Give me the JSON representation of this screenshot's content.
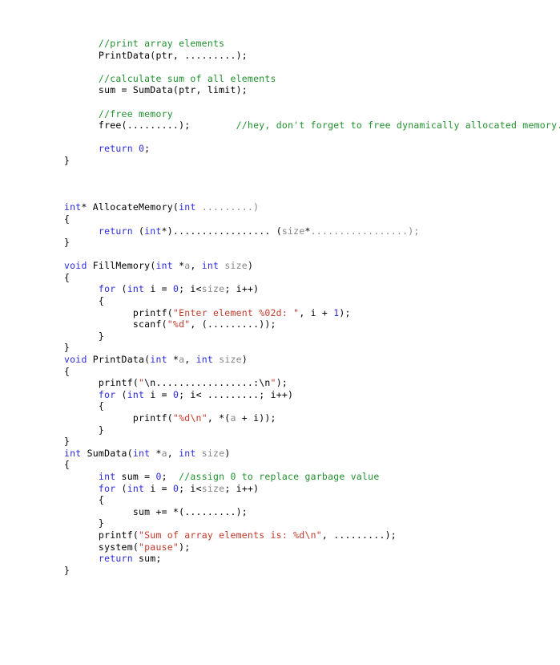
{
  "document": {
    "kind": "c-source-code-listing",
    "language": "C",
    "background_color": "#ffffff",
    "colors": {
      "keyword": "#2b2be0",
      "comment": "#22912f",
      "string": "#c23a2b",
      "identifier_grey": "#878787",
      "plain": "#000000"
    }
  },
  "code": {
    "lines": [
      {
        "indent": 6,
        "tokens": [
          {
            "t": "cmt",
            "v": "//print array elements"
          }
        ]
      },
      {
        "indent": 6,
        "tokens": [
          {
            "t": "pln",
            "v": "PrintData(ptr, .........);"
          }
        ]
      },
      {
        "indent": 0,
        "tokens": []
      },
      {
        "indent": 6,
        "tokens": [
          {
            "t": "cmt",
            "v": "//calculate sum of all elements"
          }
        ]
      },
      {
        "indent": 6,
        "tokens": [
          {
            "t": "pln",
            "v": "sum = SumData(ptr, limit);"
          }
        ]
      },
      {
        "indent": 0,
        "tokens": []
      },
      {
        "indent": 6,
        "tokens": [
          {
            "t": "cmt",
            "v": "//free memory"
          }
        ]
      },
      {
        "indent": 6,
        "tokens": [
          {
            "t": "pln",
            "v": "free(.........);"
          },
          {
            "t": "pln",
            "v": "        "
          },
          {
            "t": "cmt",
            "v": "//hey, don't forget to free dynamically allocated memory."
          }
        ]
      },
      {
        "indent": 0,
        "tokens": []
      },
      {
        "indent": 6,
        "tokens": [
          {
            "t": "kw",
            "v": "return"
          },
          {
            "t": "pln",
            "v": " "
          },
          {
            "t": "kw",
            "v": "0"
          },
          {
            "t": "pln",
            "v": ";"
          }
        ]
      },
      {
        "indent": 0,
        "tokens": [
          {
            "t": "pln",
            "v": "}"
          }
        ]
      },
      {
        "indent": 0,
        "tokens": []
      },
      {
        "indent": 0,
        "tokens": []
      },
      {
        "indent": 0,
        "tokens": []
      },
      {
        "indent": 0,
        "tokens": [
          {
            "t": "kw",
            "v": "int"
          },
          {
            "t": "pln",
            "v": "* AllocateMemory("
          },
          {
            "t": "kw",
            "v": "int"
          },
          {
            "t": "pln",
            "v": " "
          },
          {
            "t": "gry",
            "v": ".........)"
          }
        ]
      },
      {
        "indent": 0,
        "tokens": [
          {
            "t": "pln",
            "v": "{"
          }
        ]
      },
      {
        "indent": 6,
        "tokens": [
          {
            "t": "kw",
            "v": "return"
          },
          {
            "t": "pln",
            "v": " ("
          },
          {
            "t": "kw",
            "v": "int"
          },
          {
            "t": "pln",
            "v": "*)................. ("
          },
          {
            "t": "gry",
            "v": "size"
          },
          {
            "t": "pln",
            "v": "*"
          },
          {
            "t": "gry",
            "v": ".................);"
          }
        ]
      },
      {
        "indent": 0,
        "tokens": [
          {
            "t": "pln",
            "v": "}"
          }
        ]
      },
      {
        "indent": 0,
        "tokens": []
      },
      {
        "indent": 0,
        "tokens": [
          {
            "t": "kw",
            "v": "void"
          },
          {
            "t": "pln",
            "v": " FillMemory("
          },
          {
            "t": "kw",
            "v": "int"
          },
          {
            "t": "pln",
            "v": " *"
          },
          {
            "t": "gry",
            "v": "a"
          },
          {
            "t": "pln",
            "v": ", "
          },
          {
            "t": "kw",
            "v": "int"
          },
          {
            "t": "pln",
            "v": " "
          },
          {
            "t": "gry",
            "v": "size"
          },
          {
            "t": "pln",
            "v": ")"
          }
        ]
      },
      {
        "indent": 0,
        "tokens": [
          {
            "t": "pln",
            "v": "{"
          }
        ]
      },
      {
        "indent": 6,
        "tokens": [
          {
            "t": "kw",
            "v": "for"
          },
          {
            "t": "pln",
            "v": " ("
          },
          {
            "t": "kw",
            "v": "int"
          },
          {
            "t": "pln",
            "v": " i = "
          },
          {
            "t": "kw",
            "v": "0"
          },
          {
            "t": "pln",
            "v": "; i<"
          },
          {
            "t": "gry",
            "v": "size"
          },
          {
            "t": "pln",
            "v": "; i++)"
          }
        ]
      },
      {
        "indent": 6,
        "tokens": [
          {
            "t": "pln",
            "v": "{"
          }
        ]
      },
      {
        "indent": 12,
        "tokens": [
          {
            "t": "pln",
            "v": "printf("
          },
          {
            "t": "str",
            "v": "\"Enter element %02d: \""
          },
          {
            "t": "pln",
            "v": ", i + "
          },
          {
            "t": "kw",
            "v": "1"
          },
          {
            "t": "pln",
            "v": ");"
          }
        ]
      },
      {
        "indent": 12,
        "tokens": [
          {
            "t": "pln",
            "v": "scanf("
          },
          {
            "t": "str",
            "v": "\"%d\""
          },
          {
            "t": "pln",
            "v": ", (.........));"
          }
        ]
      },
      {
        "indent": 6,
        "tokens": [
          {
            "t": "pln",
            "v": "}"
          }
        ]
      },
      {
        "indent": 0,
        "tokens": [
          {
            "t": "pln",
            "v": "}"
          }
        ]
      },
      {
        "indent": 0,
        "tokens": [
          {
            "t": "kw",
            "v": "void"
          },
          {
            "t": "pln",
            "v": " PrintData("
          },
          {
            "t": "kw",
            "v": "int"
          },
          {
            "t": "pln",
            "v": " *"
          },
          {
            "t": "gry",
            "v": "a"
          },
          {
            "t": "pln",
            "v": ", "
          },
          {
            "t": "kw",
            "v": "int"
          },
          {
            "t": "pln",
            "v": " "
          },
          {
            "t": "gry",
            "v": "size"
          },
          {
            "t": "pln",
            "v": ")"
          }
        ]
      },
      {
        "indent": 0,
        "tokens": [
          {
            "t": "pln",
            "v": "{"
          }
        ]
      },
      {
        "indent": 6,
        "tokens": [
          {
            "t": "pln",
            "v": "printf("
          },
          {
            "t": "str",
            "v": "\""
          },
          {
            "t": "pln",
            "v": "\\n.................:\\n"
          },
          {
            "t": "str",
            "v": "\""
          },
          {
            "t": "pln",
            "v": ");"
          }
        ]
      },
      {
        "indent": 6,
        "tokens": [
          {
            "t": "kw",
            "v": "for"
          },
          {
            "t": "pln",
            "v": " ("
          },
          {
            "t": "kw",
            "v": "int"
          },
          {
            "t": "pln",
            "v": " i = "
          },
          {
            "t": "kw",
            "v": "0"
          },
          {
            "t": "pln",
            "v": "; i< .........; i++)"
          }
        ]
      },
      {
        "indent": 6,
        "tokens": [
          {
            "t": "pln",
            "v": "{"
          }
        ]
      },
      {
        "indent": 12,
        "tokens": [
          {
            "t": "pln",
            "v": "printf("
          },
          {
            "t": "str",
            "v": "\"%d\\n\""
          },
          {
            "t": "pln",
            "v": ", *("
          },
          {
            "t": "gry",
            "v": "a"
          },
          {
            "t": "pln",
            "v": " + i));"
          }
        ]
      },
      {
        "indent": 6,
        "tokens": [
          {
            "t": "pln",
            "v": "}"
          }
        ]
      },
      {
        "indent": 0,
        "tokens": [
          {
            "t": "pln",
            "v": "}"
          }
        ]
      },
      {
        "indent": 0,
        "tokens": [
          {
            "t": "kw",
            "v": "int"
          },
          {
            "t": "pln",
            "v": " SumData("
          },
          {
            "t": "kw",
            "v": "int"
          },
          {
            "t": "pln",
            "v": " *"
          },
          {
            "t": "gry",
            "v": "a"
          },
          {
            "t": "pln",
            "v": ", "
          },
          {
            "t": "kw",
            "v": "int"
          },
          {
            "t": "pln",
            "v": " "
          },
          {
            "t": "gry",
            "v": "size"
          },
          {
            "t": "pln",
            "v": ")"
          }
        ]
      },
      {
        "indent": 0,
        "tokens": [
          {
            "t": "pln",
            "v": "{"
          }
        ]
      },
      {
        "indent": 6,
        "tokens": [
          {
            "t": "kw",
            "v": "int"
          },
          {
            "t": "pln",
            "v": " sum = "
          },
          {
            "t": "kw",
            "v": "0"
          },
          {
            "t": "pln",
            "v": ";  "
          },
          {
            "t": "cmt",
            "v": "//assign 0 to replace garbage value"
          }
        ]
      },
      {
        "indent": 6,
        "tokens": [
          {
            "t": "kw",
            "v": "for"
          },
          {
            "t": "pln",
            "v": " ("
          },
          {
            "t": "kw",
            "v": "int"
          },
          {
            "t": "pln",
            "v": " i = "
          },
          {
            "t": "kw",
            "v": "0"
          },
          {
            "t": "pln",
            "v": "; i<"
          },
          {
            "t": "gry",
            "v": "size"
          },
          {
            "t": "pln",
            "v": "; i++)"
          }
        ]
      },
      {
        "indent": 6,
        "tokens": [
          {
            "t": "pln",
            "v": "{"
          }
        ]
      },
      {
        "indent": 12,
        "tokens": [
          {
            "t": "pln",
            "v": "sum += *(.........);"
          }
        ]
      },
      {
        "indent": 6,
        "tokens": [
          {
            "t": "pln",
            "v": "}"
          }
        ]
      },
      {
        "indent": 6,
        "tokens": [
          {
            "t": "pln",
            "v": "printf("
          },
          {
            "t": "str",
            "v": "\"Sum of array elements is: %d\\n\""
          },
          {
            "t": "pln",
            "v": ", .........);"
          }
        ]
      },
      {
        "indent": 6,
        "tokens": [
          {
            "t": "pln",
            "v": "system("
          },
          {
            "t": "str",
            "v": "\"pause\""
          },
          {
            "t": "pln",
            "v": ");"
          }
        ]
      },
      {
        "indent": 6,
        "tokens": [
          {
            "t": "kw",
            "v": "return"
          },
          {
            "t": "pln",
            "v": " sum;"
          }
        ]
      },
      {
        "indent": 0,
        "tokens": [
          {
            "t": "pln",
            "v": "}"
          }
        ]
      }
    ]
  }
}
